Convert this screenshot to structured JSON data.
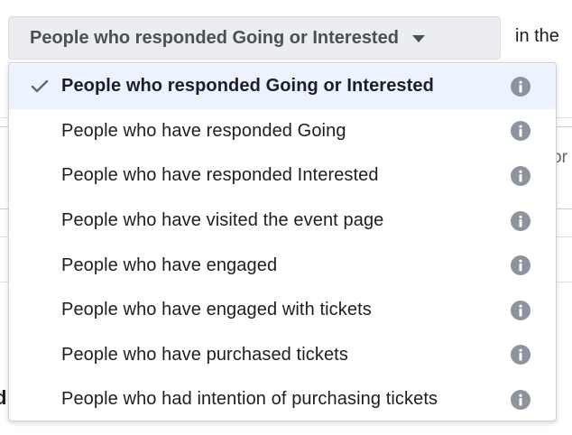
{
  "dropdown": {
    "selected_label": "People who responded Going or Interested",
    "trailing_text": "in the",
    "caret_icon": "caret-down-icon"
  },
  "background": {
    "partial_text_right": "or",
    "partial_glyph_left": "d"
  },
  "menu": {
    "items": [
      {
        "label": "People who responded Going or Interested",
        "selected": true,
        "icon": "info-icon"
      },
      {
        "label": "People who have responded Going",
        "selected": false,
        "icon": "info-icon"
      },
      {
        "label": "People who have responded Interested",
        "selected": false,
        "icon": "info-icon"
      },
      {
        "label": "People who have visited the event page",
        "selected": false,
        "icon": "info-icon"
      },
      {
        "label": "People who have engaged",
        "selected": false,
        "icon": "info-icon"
      },
      {
        "label": "People who have engaged with tickets",
        "selected": false,
        "icon": "info-icon"
      },
      {
        "label": "People who have purchased tickets",
        "selected": false,
        "icon": "info-icon"
      },
      {
        "label": "People who had intention of purchasing tickets",
        "selected": false,
        "icon": "info-icon"
      }
    ]
  },
  "colors": {
    "selected_row_bg": "#ecf3ff",
    "info_icon": "#8d949e",
    "check_icon": "#606770",
    "trigger_bg": "#ebedf0"
  }
}
